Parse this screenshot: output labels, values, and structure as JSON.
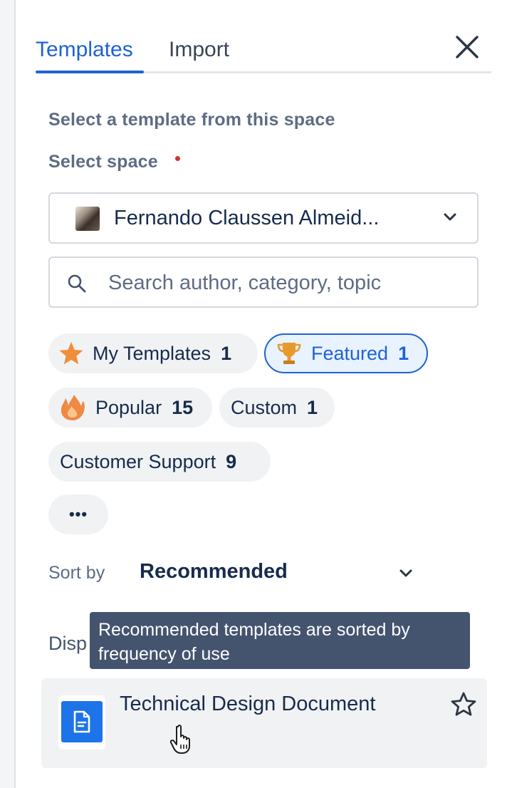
{
  "tabs": [
    {
      "label": "Templates",
      "active": true
    },
    {
      "label": "Import",
      "active": false
    }
  ],
  "close_icon": "close-icon",
  "section_description": "Select a template from this space",
  "space_select": {
    "label": "Select space",
    "required": true,
    "value": "Fernando Claussen Almeid...",
    "icon": "chevron-down-icon"
  },
  "search": {
    "placeholder": "Search author, category, topic",
    "value": "",
    "icon": "search-icon"
  },
  "filters": [
    {
      "label": "My Templates",
      "count": "1",
      "icon": "star-icon",
      "selected": false
    },
    {
      "label": "Featured",
      "count": "1",
      "icon": "trophy-icon",
      "selected": true
    },
    {
      "label": "Popular",
      "count": "15",
      "icon": "flame-icon",
      "selected": false
    },
    {
      "label": "Custom",
      "count": "1",
      "selected": false
    },
    {
      "label": "Customer Support",
      "count": "9",
      "selected": false
    },
    {
      "label": "•••",
      "icon": "more-icon",
      "selected": false
    }
  ],
  "sort": {
    "label": "Sort by",
    "value": "Recommended",
    "icon": "chevron-down-icon"
  },
  "display_label_partial": "Disp",
  "tooltip": {
    "text": "Recommended templates are sorted by frequency of use"
  },
  "templates": [
    {
      "title": "Technical Design Document",
      "icon": "document-icon",
      "favorite_icon": "star-outline-icon"
    }
  ],
  "colors": {
    "accent": "#1d62d6",
    "tooltip_bg": "#44546f",
    "chip_bg": "#f1f2f4",
    "required": "#c9372c"
  }
}
